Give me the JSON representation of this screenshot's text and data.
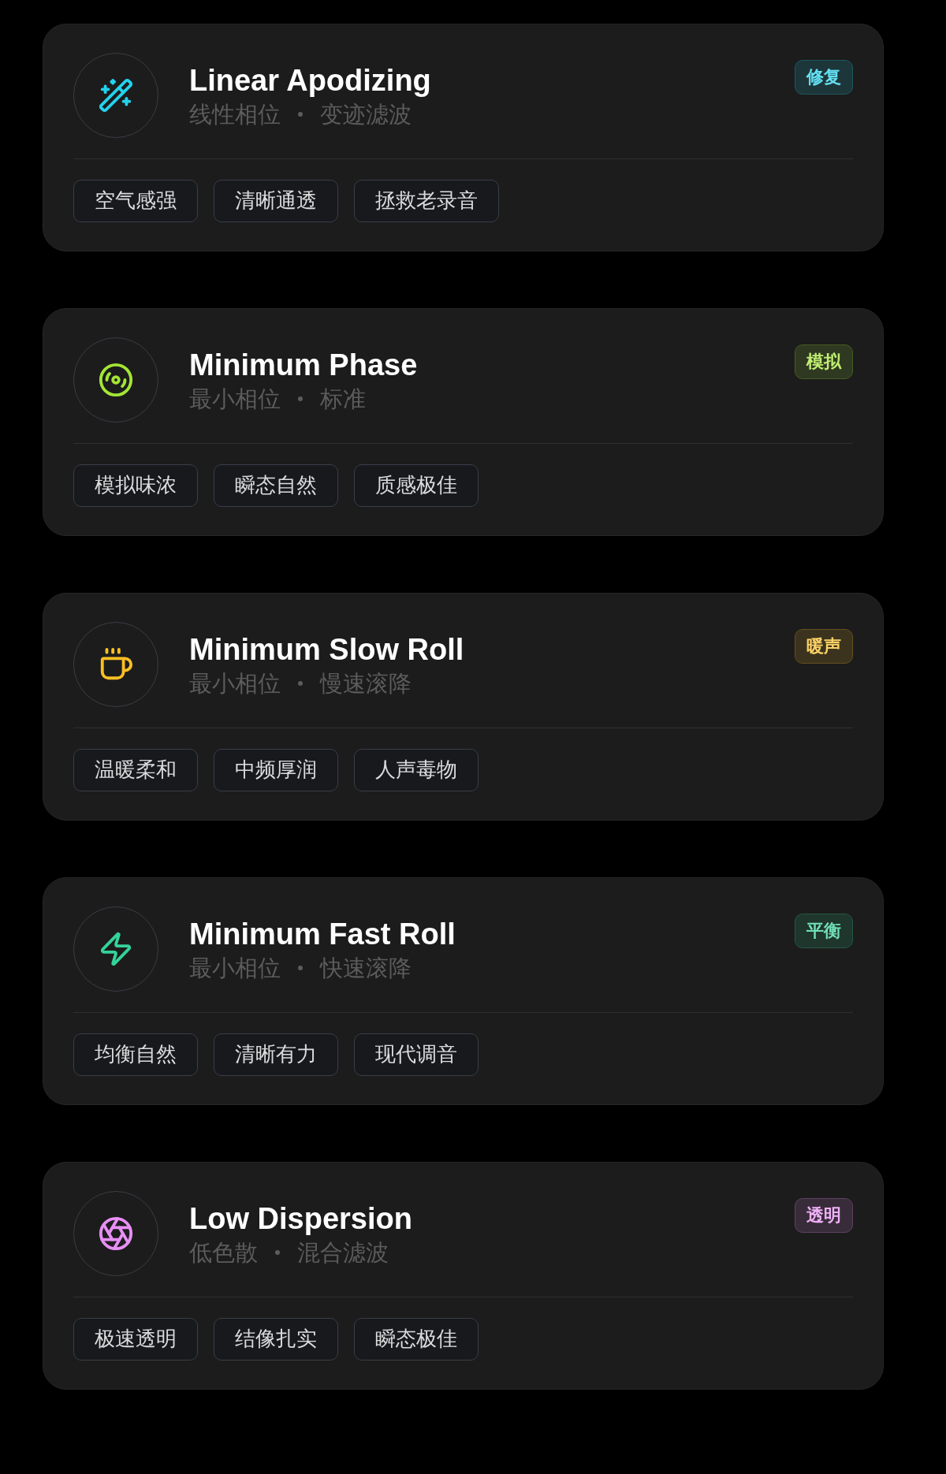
{
  "cards": [
    {
      "title": "Linear Apodizing",
      "subtitle": [
        "线性相位",
        "变迹滤波"
      ],
      "badge": "修复",
      "color": "#22d3ee",
      "tags": [
        "空气感强",
        "清晰通透",
        "拯救老录音"
      ]
    },
    {
      "title": "Minimum Phase",
      "subtitle": [
        "最小相位",
        "标准"
      ],
      "badge": "模拟",
      "color": "#a3e635",
      "tags": [
        "模拟味浓",
        "瞬态自然",
        "质感极佳"
      ]
    },
    {
      "title": "Minimum Slow Roll",
      "subtitle": [
        "最小相位",
        "慢速滚降"
      ],
      "badge": "暖声",
      "color": "#fbbf24",
      "tags": [
        "温暖柔和",
        "中频厚润",
        "人声毒物"
      ]
    },
    {
      "title": "Minimum Fast Roll",
      "subtitle": [
        "最小相位",
        "快速滚降"
      ],
      "badge": "平衡",
      "color": "#34d399",
      "tags": [
        "均衡自然",
        "清晰有力",
        "现代调音"
      ]
    },
    {
      "title": "Low Dispersion",
      "subtitle": [
        "低色散",
        "混合滤波"
      ],
      "badge": "透明",
      "color": "#e88ff5",
      "tags": [
        "极速透明",
        "结像扎实",
        "瞬态极佳"
      ]
    }
  ]
}
